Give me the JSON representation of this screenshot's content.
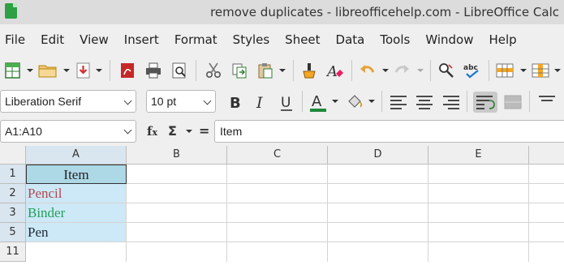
{
  "window": {
    "title": "remove duplicates - libreofficehelp.com - LibreOffice Calc"
  },
  "menu": [
    "File",
    "Edit",
    "View",
    "Insert",
    "Format",
    "Styles",
    "Sheet",
    "Data",
    "Tools",
    "Window",
    "Help"
  ],
  "toolbar": {
    "font_name": "Liberation Serif",
    "font_size": "10 pt"
  },
  "formula_bar": {
    "name_box": "A1:A10",
    "content": "Item"
  },
  "grid": {
    "columns": [
      "A",
      "B",
      "C",
      "D",
      "E"
    ],
    "rows": [
      {
        "number": "1",
        "a": "Item"
      },
      {
        "number": "2",
        "a": "Pencil"
      },
      {
        "number": "3",
        "a": "Binder"
      },
      {
        "number": "5",
        "a": "Pen"
      },
      {
        "number": "11",
        "a": ""
      }
    ]
  },
  "colors": {
    "header_fill": "#add8e6",
    "selection_fill": "#cde8f6",
    "pencil_text": "#b0494f",
    "binder_text": "#22a05a",
    "pen_text": "#1f2a38"
  }
}
